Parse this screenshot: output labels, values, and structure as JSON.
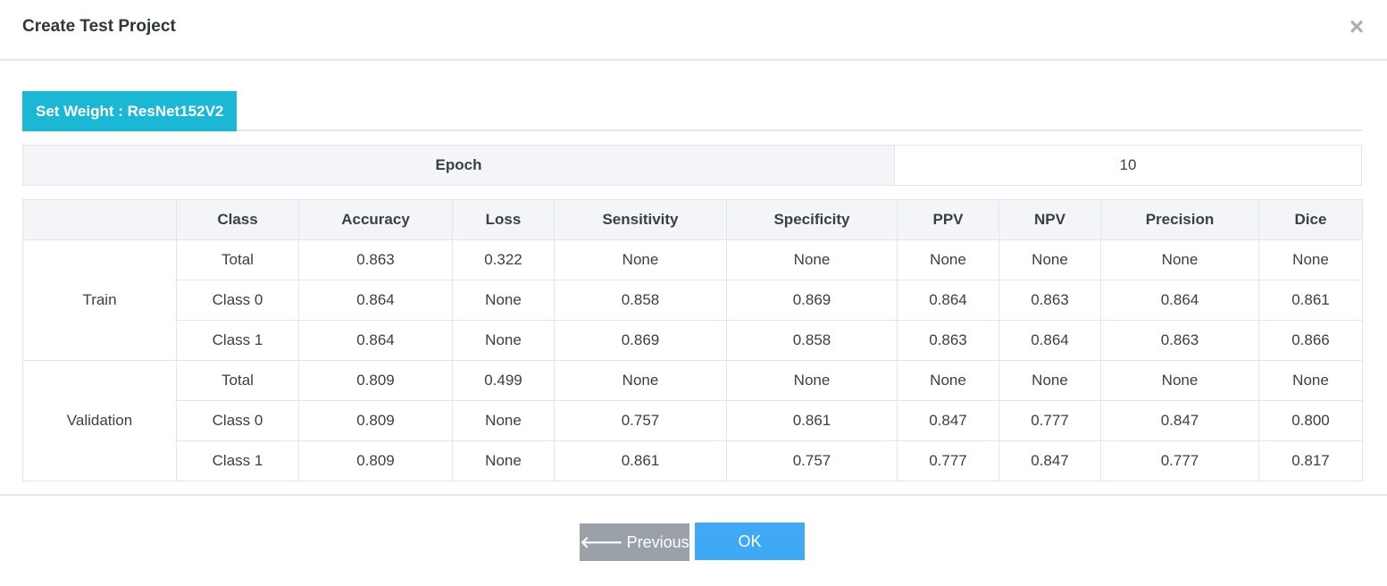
{
  "header": {
    "title": "Create Test Project",
    "close_glyph": "×"
  },
  "tab": {
    "label": "Set Weight : ResNet152V2"
  },
  "epoch": {
    "label": "Epoch",
    "value": "10"
  },
  "metrics": {
    "columns": [
      "",
      "Class",
      "Accuracy",
      "Loss",
      "Sensitivity",
      "Specificity",
      "PPV",
      "NPV",
      "Precision",
      "Dice"
    ],
    "groups": [
      {
        "name": "Train",
        "rows": [
          [
            "Total",
            "0.863",
            "0.322",
            "None",
            "None",
            "None",
            "None",
            "None",
            "None"
          ],
          [
            "Class 0",
            "0.864",
            "None",
            "0.858",
            "0.869",
            "0.864",
            "0.863",
            "0.864",
            "0.861"
          ],
          [
            "Class 1",
            "0.864",
            "None",
            "0.869",
            "0.858",
            "0.863",
            "0.864",
            "0.863",
            "0.866"
          ]
        ]
      },
      {
        "name": "Validation",
        "rows": [
          [
            "Total",
            "0.809",
            "0.499",
            "None",
            "None",
            "None",
            "None",
            "None",
            "None"
          ],
          [
            "Class 0",
            "0.809",
            "None",
            "0.757",
            "0.861",
            "0.847",
            "0.777",
            "0.847",
            "0.800"
          ],
          [
            "Class 1",
            "0.809",
            "None",
            "0.861",
            "0.757",
            "0.777",
            "0.847",
            "0.777",
            "0.817"
          ]
        ]
      }
    ]
  },
  "footer": {
    "previous_label": "Previous",
    "previous_icon": "arrow-left-icon",
    "ok_label": "OK"
  },
  "colors": {
    "tab_accent": "#1bb8d5",
    "ok_button": "#3fa9f5",
    "previous_button": "#9aa1a8"
  }
}
